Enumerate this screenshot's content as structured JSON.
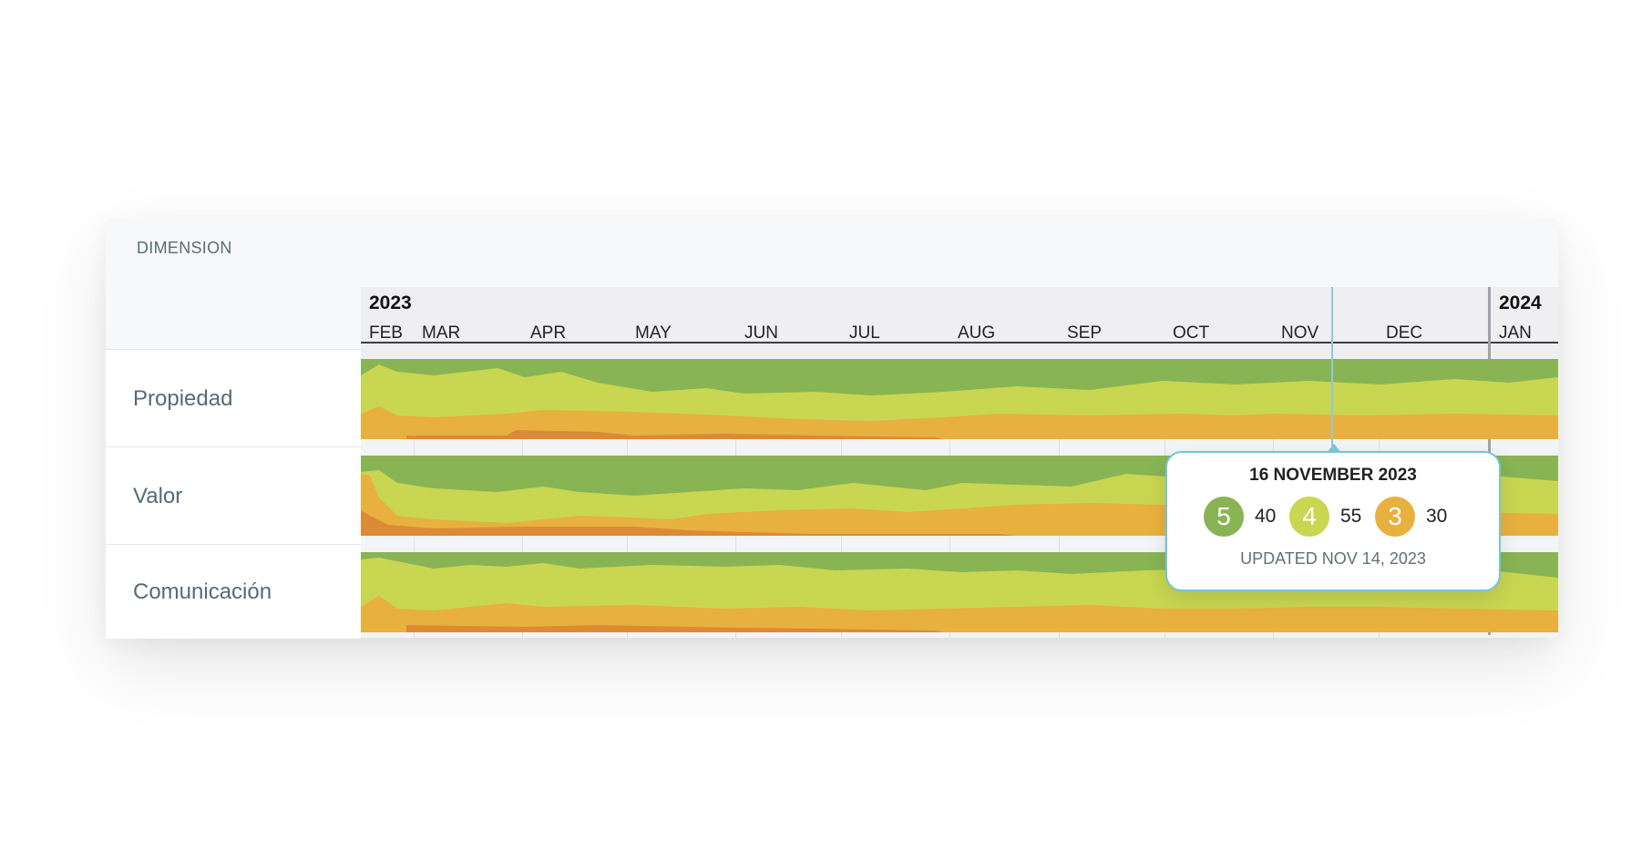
{
  "panel": {
    "title": "DIMENSION"
  },
  "timeline": {
    "years": [
      {
        "label": "2023"
      },
      {
        "label": "2024"
      }
    ],
    "months": [
      "FEB",
      "MAR",
      "APR",
      "MAY",
      "JUN",
      "JUL",
      "AUG",
      "SEP",
      "OCT",
      "NOV",
      "DEC",
      "JAN"
    ]
  },
  "rows": [
    {
      "label": "Propiedad"
    },
    {
      "label": "Valor"
    },
    {
      "label": "Comunicación"
    }
  ],
  "colors": {
    "score5": "#88b453",
    "score4": "#c8d651",
    "score3": "#e8b13f",
    "score2": "#dc8a35"
  },
  "tooltip": {
    "date": "16 NOVEMBER 2023",
    "scores": [
      {
        "score": "5",
        "count": "40",
        "color": "#88b453"
      },
      {
        "score": "4",
        "count": "55",
        "color": "#c8d651"
      },
      {
        "score": "3",
        "count": "30",
        "color": "#e8b13f"
      }
    ],
    "updated": "UPDATED NOV 14, 2023"
  }
}
